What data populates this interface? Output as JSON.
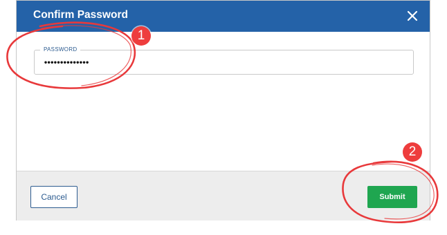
{
  "dialog": {
    "title": "Confirm Password",
    "close_icon": "close-icon"
  },
  "password_field": {
    "label": "PASSWORD",
    "value": "••••••••••••••"
  },
  "footer": {
    "cancel_label": "Cancel",
    "submit_label": "Submit"
  },
  "annotations": {
    "marker_1": "1",
    "marker_2": "2",
    "color": "#e8393b"
  },
  "colors": {
    "header": "#2462a8",
    "submit": "#1fa650",
    "cancel_border": "#2c5b8f",
    "footer": "#ededed"
  }
}
